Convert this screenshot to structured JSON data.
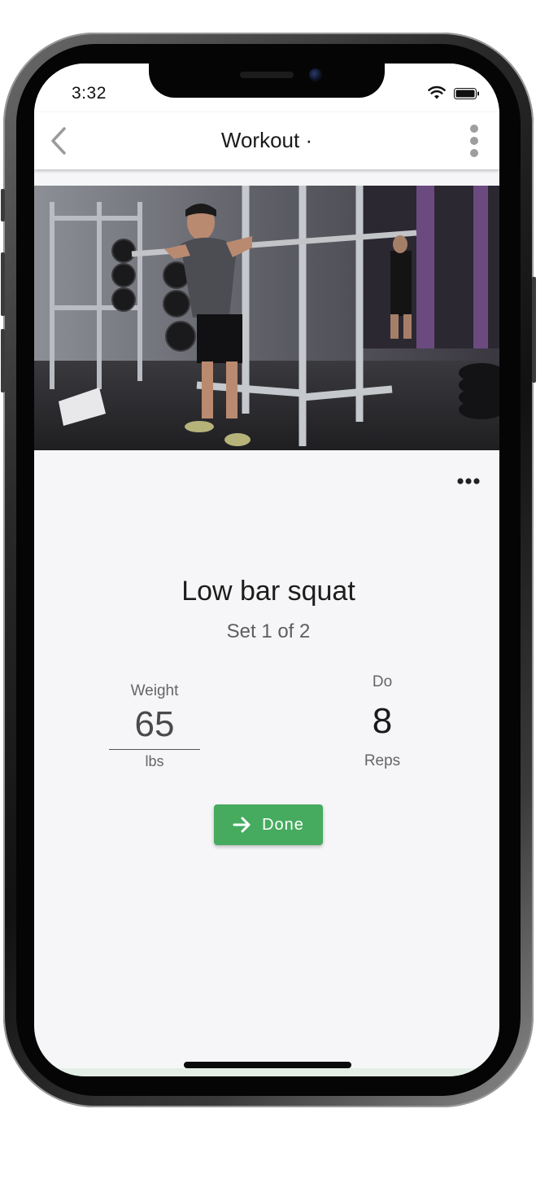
{
  "status_bar": {
    "time": "3:32"
  },
  "app_bar": {
    "title": "Workout ·",
    "back_icon": "chevron-left-icon",
    "menu_icon": "more-vert-icon"
  },
  "video": {
    "description_icon": "exercise-video"
  },
  "exercise": {
    "name": "Low bar squat",
    "set_progress": "Set 1 of 2",
    "weight": {
      "label": "Weight",
      "value": "65",
      "unit": "lbs"
    },
    "reps": {
      "label": "Do",
      "value": "8",
      "unit": "Reps"
    },
    "done_label": "Done"
  },
  "colors": {
    "accent": "#46ab5f",
    "background": "#f6f6f8"
  }
}
